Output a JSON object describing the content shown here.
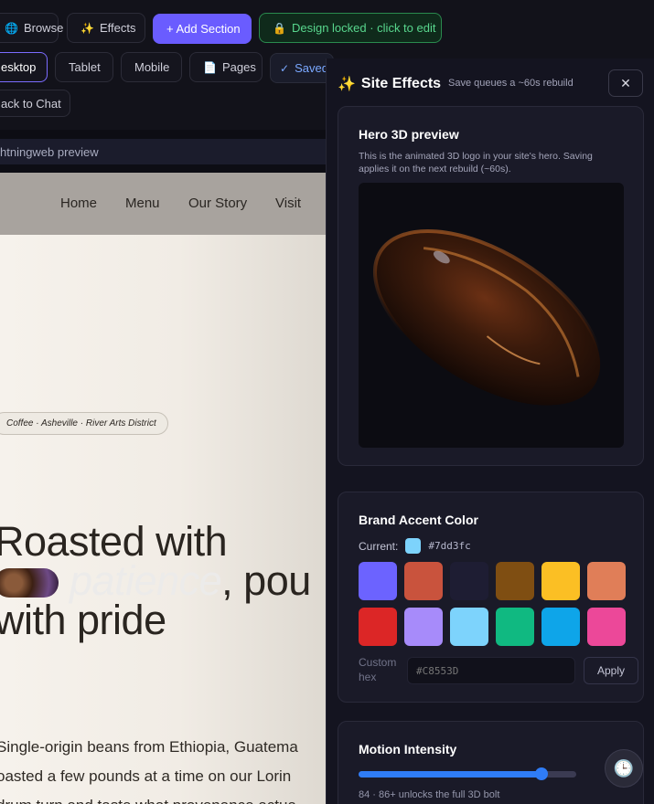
{
  "toolbar": {
    "browse_label": "Browse",
    "effects_label": "Effects",
    "add_section_label": "+ Add Section",
    "design_locked_label": "Design locked · click to edit",
    "views": [
      "esktop",
      "Tablet",
      "Mobile"
    ],
    "pages_label": "Pages",
    "saved_label": "Saved",
    "back_label": "ack to Chat"
  },
  "preview_bar": {
    "title": "htningweb preview"
  },
  "site": {
    "nav": [
      "Home",
      "Menu",
      "Our Story",
      "Visit"
    ],
    "tagline": "Coffee · Asheville · River Arts District",
    "headline_line1": "Roasted with",
    "headline_ghost": "patience",
    "headline_line2_tail": ", pou",
    "headline_line3": "with pride",
    "body_lines": [
      "Single-origin beans from Ethiopia, Guatema",
      "oasted a few pounds at a time on our Lorin",
      "drum turn and taste what provenance actua"
    ]
  },
  "panel": {
    "title": "Site Effects",
    "subtitle": "Save queues a ~60s rebuild",
    "close_icon": "close-icon",
    "hero": {
      "title": "Hero 3D preview",
      "description": "This is the animated 3D logo in your site's hero. Saving applies it on the next rebuild (~60s)."
    },
    "brand": {
      "title": "Brand Accent Color",
      "current_label": "Current:",
      "current_hex": "#7dd3fc",
      "swatches": [
        "#6c63ff",
        "#c9533d",
        "#1e1d33",
        "#7f4e12",
        "#fbbf24",
        "#e07e58",
        "#dc2626",
        "#a78bfa",
        "#7dd3fc",
        "#10b981",
        "#0ea5e9",
        "#ec4899"
      ],
      "custom_label": "Custom hex",
      "custom_placeholder": "#C8553D",
      "apply_label": "Apply"
    },
    "motion": {
      "title": "Motion Intensity",
      "value": 84,
      "note": "84 · 86+ unlocks the full 3D bolt"
    }
  },
  "colors": {
    "accent": "#6a5cff",
    "locked_green": "#58d68d",
    "slider_blue": "#2f7cf6"
  }
}
